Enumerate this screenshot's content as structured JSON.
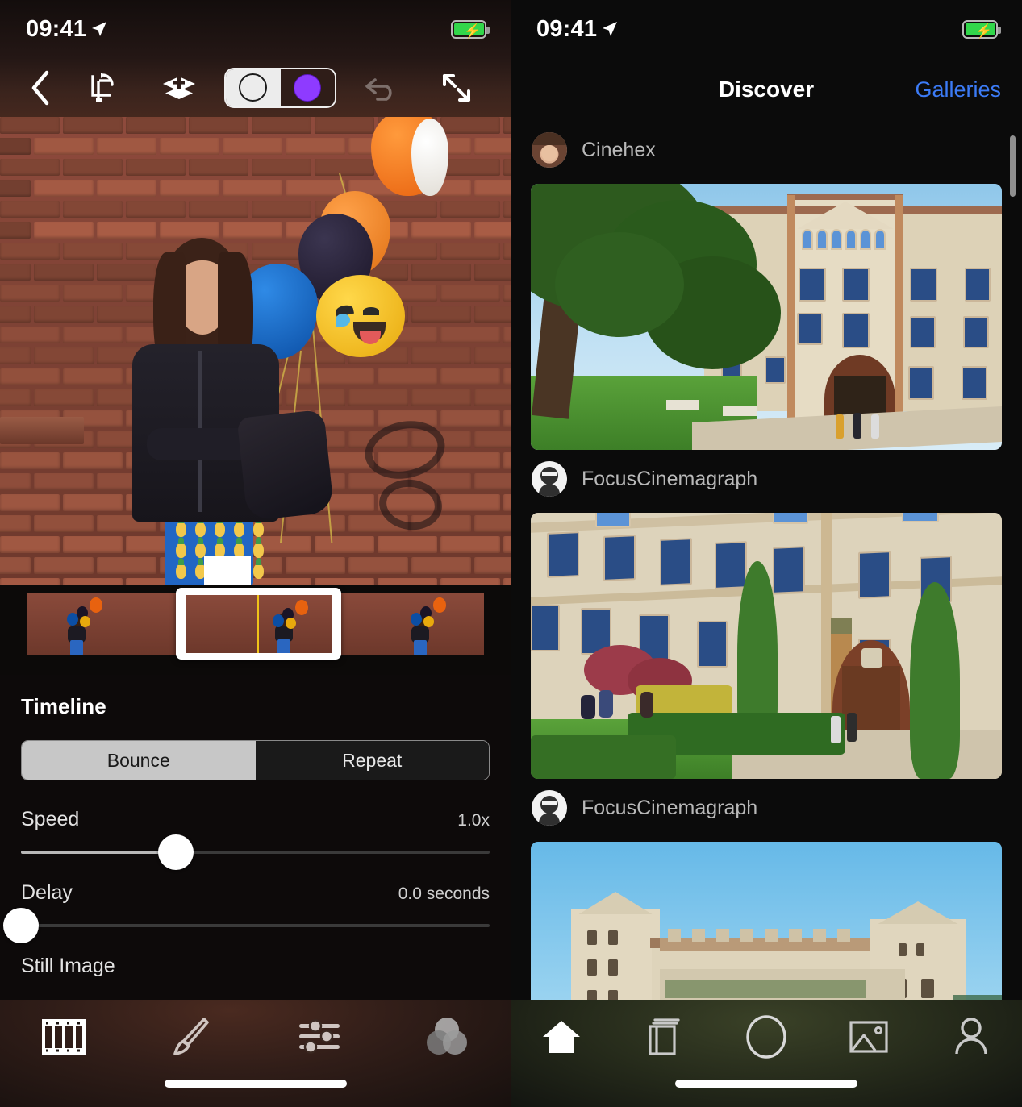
{
  "left_panel": {
    "status_bar": {
      "time": "09:41",
      "location_icon": "location-arrow-icon",
      "battery_icon": "battery-charging-icon"
    },
    "toolbar": {
      "back_icon": "chevron-left-icon",
      "crop_label": "crop-rotate-icon",
      "layers_label": "add-layer-icon",
      "mask_toggle": {
        "option_left_icon": "circle-outline-icon",
        "option_right_icon": "purple-dot-icon",
        "selected": "option_left"
      },
      "undo_icon": "undo-icon",
      "expand_icon": "expand-arrows-icon"
    },
    "filmstrip": {
      "playhead_icon": "playhead-marker-icon",
      "selection_marker_color": "#f0c419"
    },
    "controls": {
      "section_title": "Timeline",
      "mode_segmented": {
        "options": [
          "Bounce",
          "Repeat"
        ],
        "selected": "Bounce"
      },
      "speed": {
        "label": "Speed",
        "value": "1.0x",
        "percent": 33
      },
      "delay": {
        "label": "Delay",
        "value": "0.0 seconds",
        "percent": 0
      },
      "still_image": {
        "label": "Still Image"
      }
    },
    "tabbar": {
      "items": [
        {
          "name": "filmstrip",
          "icon": "film-strip-icon",
          "active": true
        },
        {
          "name": "brush",
          "icon": "paintbrush-icon",
          "active": false
        },
        {
          "name": "adjustments",
          "icon": "sliders-icon",
          "active": false
        },
        {
          "name": "color",
          "icon": "color-circles-icon",
          "active": false
        }
      ]
    }
  },
  "right_panel": {
    "status_bar": {
      "time": "09:41",
      "location_icon": "location-arrow-icon",
      "battery_icon": "battery-charging-icon"
    },
    "nav": {
      "title": "Discover",
      "action_label": "Galleries"
    },
    "feed": {
      "items": [
        {
          "username": "Cinehex",
          "avatar_icon": "user-photo-avatar",
          "media_caption_position": "above"
        },
        {
          "username": "FocusCinemagraph",
          "avatar_icon": "user-face-avatar",
          "media_caption_position": "below"
        },
        {
          "username": "FocusCinemagraph",
          "avatar_icon": "user-face-avatar",
          "media_caption_position": "below"
        }
      ]
    },
    "tabbar": {
      "items": [
        {
          "name": "home",
          "icon": "home-icon",
          "active": true
        },
        {
          "name": "library",
          "icon": "book-icon",
          "active": false
        },
        {
          "name": "capture",
          "icon": "circle-icon",
          "active": false
        },
        {
          "name": "gallery",
          "icon": "photo-icon",
          "active": false
        },
        {
          "name": "profile",
          "icon": "person-icon",
          "active": false
        }
      ]
    }
  },
  "colors": {
    "accent_blue": "#3c7bf6",
    "accent_purple": "#8e3bff",
    "battery_green": "#32d74b",
    "playhead_yellow": "#f0c419",
    "segment_active_bg": "#c7c7c7"
  }
}
